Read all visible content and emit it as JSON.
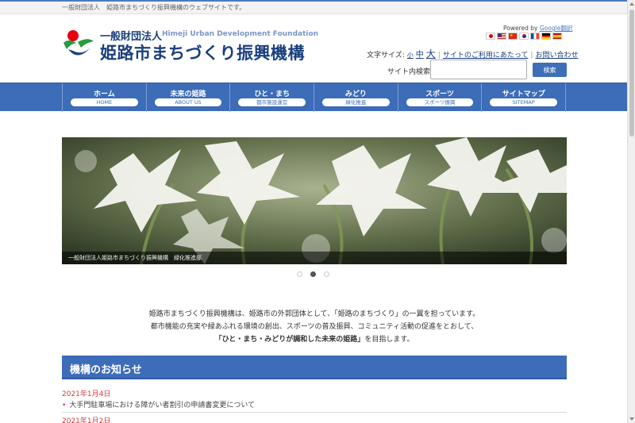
{
  "topbar": {
    "text": "一般財団法人　姫路市まちづくり振興機構のウェブサイトです。"
  },
  "logo": {
    "small": "一般財団法人",
    "english": "Himeji Urban Development Foundation",
    "main": "姫路市まちづくり振興機構",
    "colors": {
      "red": "#e60012",
      "green": "#2a9a3c",
      "blue": "#1b3f7e"
    }
  },
  "translate": {
    "powered_prefix": "Powered by",
    "google_link": "Google翻訳",
    "flags": [
      "japan-flag-icon",
      "usa-flag-icon",
      "china-flag-icon",
      "korea-flag-icon",
      "france-flag-icon",
      "germany-flag-icon",
      "spain-flag-icon"
    ]
  },
  "fontsize": {
    "label": "文字サイズ:",
    "small": "小",
    "medium": "中",
    "large": "大",
    "link_usage": "サイトのご利用にあたって",
    "link_contact": "お問い合わせ",
    "separator": "|"
  },
  "search": {
    "label": "サイト内検索:",
    "value": "",
    "placeholder": "",
    "button": "検索"
  },
  "nav": [
    {
      "jp": "ホーム",
      "en": "HOME"
    },
    {
      "jp": "未来の姫路",
      "en": "ABOUT US"
    },
    {
      "jp": "ひと・まち",
      "en": "都市施設運営"
    },
    {
      "jp": "みどり",
      "en": "緑化推進"
    },
    {
      "jp": "スポーツ",
      "en": "スポーツ振興"
    },
    {
      "jp": "サイトマップ",
      "en": "SITEMAP"
    }
  ],
  "hero": {
    "caption": "一般財団法人姫路市まちづくり振興機構　緑化推進部",
    "active_slide": 2,
    "slide_count": 3
  },
  "intro": {
    "line1": "姫路市まちづくり振興機構は、姫路市の外郭団体として、「姫路のまちづくり」の一翼を担っています。",
    "line2": "都市機能の充実や緑あふれる環境の創出、スポーツの普及振興、コミュニティ活動の促進をとおして、",
    "line3_bold": "「ひと・まち・みどりが調和した未来の姫路」",
    "line3_rest": "を目指します。"
  },
  "news": {
    "heading": "機構のお知らせ",
    "items": [
      {
        "date": "2021年1月4日",
        "title": "大手門駐車場における障がい者割引の申請書変更について"
      },
      {
        "date": "2021年1月2日",
        "title": ""
      }
    ]
  },
  "colors": {
    "nav_blue": "#3d6cb8",
    "date_red": "#d23b3b"
  }
}
